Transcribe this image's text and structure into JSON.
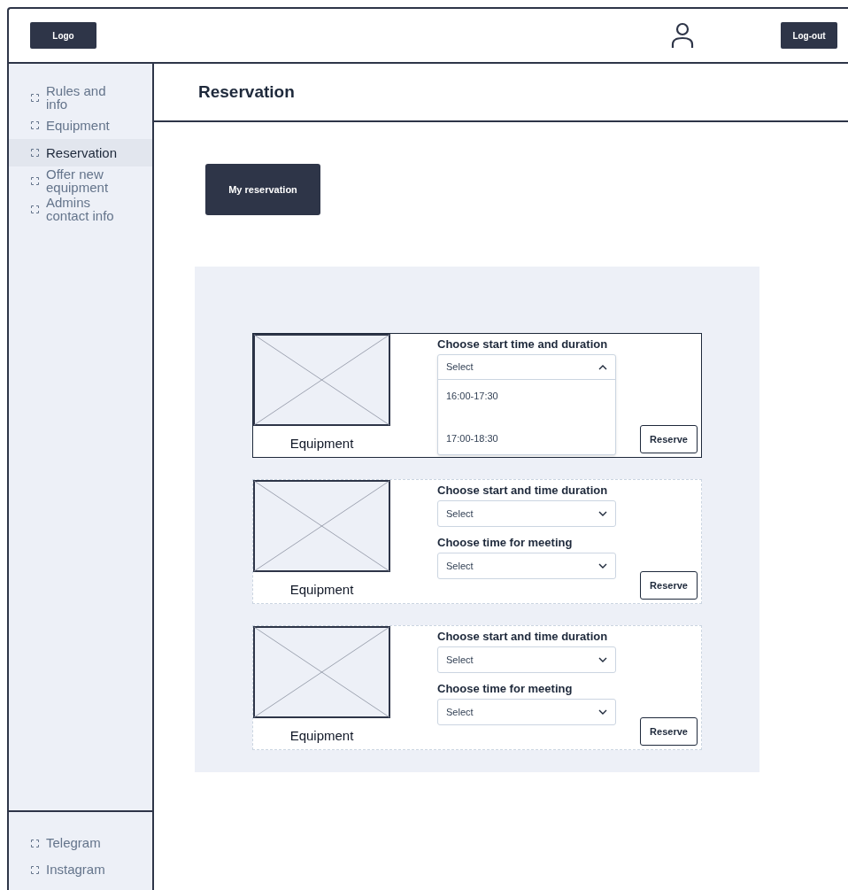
{
  "header": {
    "logo": "Logo",
    "logout": "Log-out"
  },
  "sidebar": {
    "items": [
      {
        "label": "Rules and info",
        "selected": false
      },
      {
        "label": "Equipment",
        "selected": false
      },
      {
        "label": "Reservation",
        "selected": true
      },
      {
        "label": "Offer new equipment",
        "selected": false
      },
      {
        "label": "Admins contact info",
        "selected": false
      }
    ],
    "footer_items": [
      {
        "label": "Telegram"
      },
      {
        "label": "Instagram"
      }
    ]
  },
  "page_title": "Reservation",
  "my_reservation_button": "My reservation",
  "cards": [
    {
      "selected": true,
      "name": "Equipment",
      "button": "Reserve",
      "selects": [
        {
          "label": "Choose start time and duration",
          "value": "Select",
          "expanded": true,
          "options": [
            "16:00-17:30",
            "17:00-18:30"
          ]
        }
      ]
    },
    {
      "selected": false,
      "name": "Equipment",
      "button": "Reserve",
      "selects": [
        {
          "label": "Choose start and time duration",
          "value": "Select",
          "expanded": false
        },
        {
          "label": "Choose time for meeting",
          "value": "Select",
          "expanded": false
        }
      ]
    },
    {
      "selected": false,
      "name": "Equipment",
      "button": "Reserve",
      "selects": [
        {
          "label": "Choose start and time duration",
          "value": "Select",
          "expanded": false
        },
        {
          "label": "Choose time for meeting",
          "value": "Select",
          "expanded": false
        }
      ]
    }
  ]
}
